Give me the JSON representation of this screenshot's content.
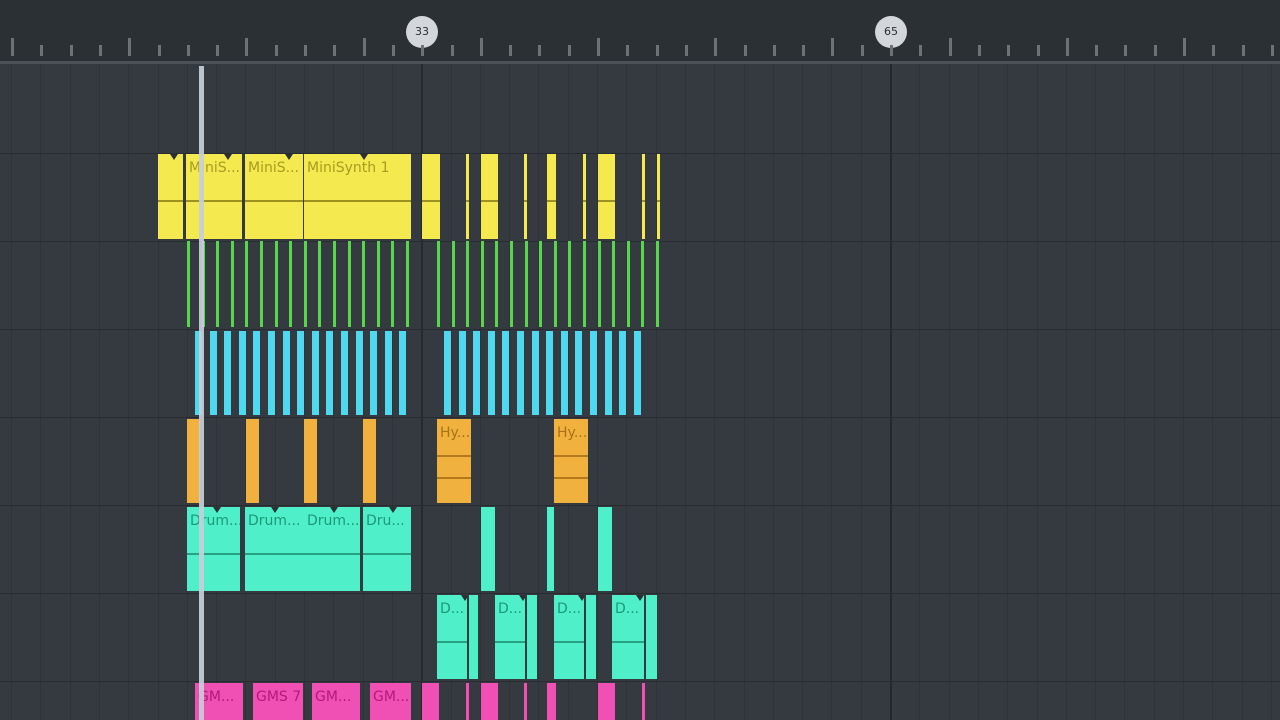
{
  "timeline": {
    "markers": [
      {
        "value": "33"
      },
      {
        "value": "65"
      }
    ]
  },
  "tracks": [
    {
      "name": "track-minisynth",
      "color": "#f4e94e",
      "clips": [
        {
          "label": ""
        },
        {
          "label": "MiniS..."
        },
        {
          "label": "MiniS..."
        },
        {
          "label": "MiniSynth 1"
        }
      ]
    },
    {
      "name": "track-green-pattern",
      "color": "#58d64b",
      "clips": []
    },
    {
      "name": "track-cyan-pattern",
      "color": "#4fd9f0",
      "clips": []
    },
    {
      "name": "track-hy",
      "color": "#f0b13e",
      "clips": [
        {
          "label": "Hy..."
        },
        {
          "label": "Hy..."
        }
      ]
    },
    {
      "name": "track-drum",
      "color": "#4ff0c9",
      "clips": [
        {
          "label": "Drum..."
        },
        {
          "label": "Drum..."
        },
        {
          "label": "Drum..."
        },
        {
          "label": "Dru..."
        }
      ]
    },
    {
      "name": "track-d",
      "color": "#4ff0c9",
      "clips": [
        {
          "label": "D..."
        },
        {
          "label": "D..."
        },
        {
          "label": "D..."
        },
        {
          "label": "D..."
        }
      ]
    },
    {
      "name": "track-gms",
      "color": "#f04fb4",
      "clips": [
        {
          "label": "GM..."
        },
        {
          "label": "GMS 7"
        },
        {
          "label": "GM..."
        },
        {
          "label": "GM..."
        }
      ]
    }
  ]
}
